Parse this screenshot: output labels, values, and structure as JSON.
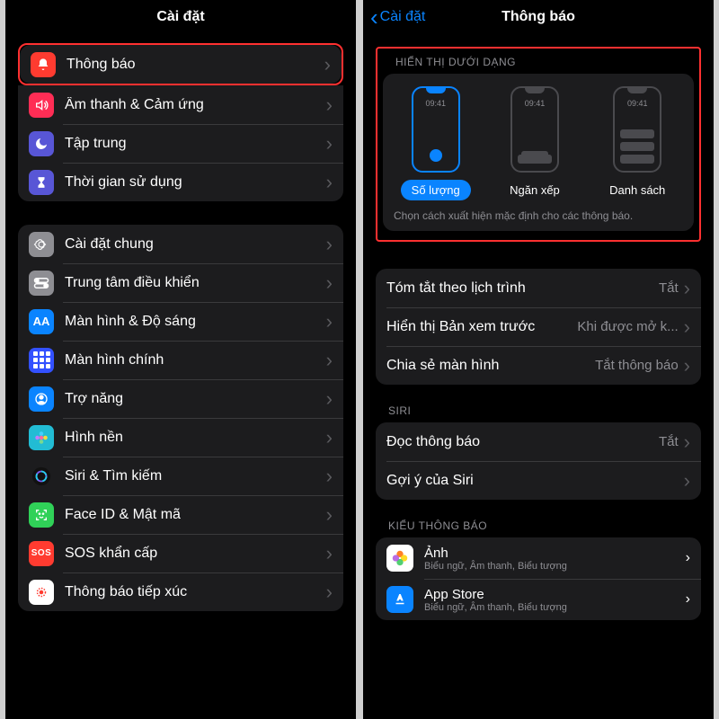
{
  "left": {
    "title": "Cài đặt",
    "groups": [
      {
        "highlight": "row0",
        "rows": [
          {
            "id": "notifications",
            "label": "Thông báo",
            "icon": "bell",
            "bg": "#ff3b30"
          },
          {
            "id": "sounds",
            "label": "Âm thanh & Cảm ứng",
            "icon": "speaker",
            "bg": "#ff2d55"
          },
          {
            "id": "focus",
            "label": "Tập trung",
            "icon": "moon",
            "bg": "#5856d6"
          },
          {
            "id": "screentime",
            "label": "Thời gian sử dụng",
            "icon": "hourglass",
            "bg": "#5856d6"
          }
        ]
      },
      {
        "rows": [
          {
            "id": "general",
            "label": "Cài đặt chung",
            "icon": "gear",
            "bg": "#8e8e93"
          },
          {
            "id": "controlcenter",
            "label": "Trung tâm điều khiển",
            "icon": "switches",
            "bg": "#8e8e93"
          },
          {
            "id": "display",
            "label": "Màn hình & Độ sáng",
            "icon": "AA",
            "bg": "#0a84ff"
          },
          {
            "id": "homescreen",
            "label": "Màn hình chính",
            "icon": "grid",
            "bg": "#3351ff"
          },
          {
            "id": "accessibility",
            "label": "Trợ năng",
            "icon": "person",
            "bg": "#0a84ff"
          },
          {
            "id": "wallpaper",
            "label": "Hình nền",
            "icon": "flower",
            "bg": "#22bcd4"
          },
          {
            "id": "siri",
            "label": "Siri & Tìm kiếm",
            "icon": "siri",
            "bg": "#1c1c1e"
          },
          {
            "id": "faceid",
            "label": "Face ID & Mật mã",
            "icon": "face",
            "bg": "#30d158"
          },
          {
            "id": "sos",
            "label": "SOS khẩn cấp",
            "icon": "SOS",
            "bg": "#ff3b30"
          },
          {
            "id": "exposure",
            "label": "Thông báo tiếp xúc",
            "icon": "exposure",
            "bg": "#ffffff"
          }
        ]
      }
    ]
  },
  "right": {
    "back": "Cài đặt",
    "title": "Thông báo",
    "displayAs": {
      "header": "HIỂN THỊ DƯỚI DẠNG",
      "time": "09:41",
      "options": [
        {
          "label": "Số lượng",
          "style": "count",
          "active": true
        },
        {
          "label": "Ngăn xếp",
          "style": "stack",
          "active": false
        },
        {
          "label": "Danh sách",
          "style": "list",
          "active": false
        }
      ],
      "footer": "Chọn cách xuất hiện mặc định cho các thông báo."
    },
    "settingsRows": [
      {
        "label": "Tóm tắt theo lịch trình",
        "value": "Tắt"
      },
      {
        "label": "Hiển thị Bản xem trước",
        "value": "Khi được mở k..."
      },
      {
        "label": "Chia sẻ màn hình",
        "value": "Tắt thông báo"
      }
    ],
    "siri": {
      "header": "SIRI",
      "rows": [
        {
          "label": "Đọc thông báo",
          "value": "Tắt"
        },
        {
          "label": "Gợi ý của Siri",
          "value": ""
        }
      ]
    },
    "style": {
      "header": "KIỂU THÔNG BÁO",
      "apps": [
        {
          "name": "Ảnh",
          "sub": "Biểu ngữ, Âm thanh, Biểu tượng",
          "icon": "photos"
        },
        {
          "name": "App Store",
          "sub": "Biểu ngữ, Âm thanh, Biểu tượng",
          "icon": "appstore"
        }
      ]
    }
  }
}
